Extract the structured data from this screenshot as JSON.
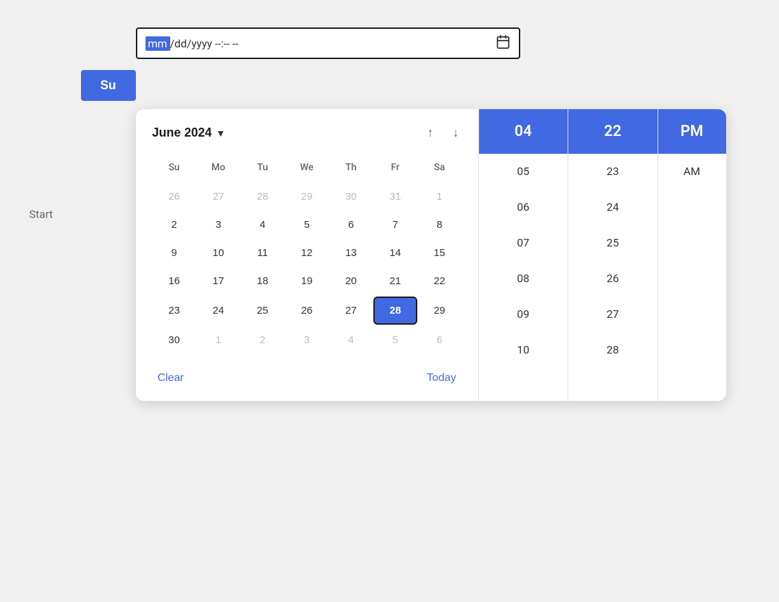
{
  "header": {
    "start_label": "Start",
    "input_placeholder": "mm/dd/yyyy --:-- --",
    "input_mm": "mm",
    "input_rest": "/dd/yyyy --:-- --",
    "calendar_icon": "📅"
  },
  "su_button": "Su",
  "calendar": {
    "month_year": "June 2024",
    "day_headers": [
      "Su",
      "Mo",
      "Tu",
      "We",
      "Th",
      "Fr",
      "Sa"
    ],
    "weeks": [
      [
        {
          "day": "26",
          "type": "other-month"
        },
        {
          "day": "27",
          "type": "other-month"
        },
        {
          "day": "28",
          "type": "other-month"
        },
        {
          "day": "29",
          "type": "other-month"
        },
        {
          "day": "30",
          "type": "other-month"
        },
        {
          "day": "31",
          "type": "other-month"
        },
        {
          "day": "1",
          "type": "other-month"
        }
      ],
      [
        {
          "day": "2",
          "type": ""
        },
        {
          "day": "3",
          "type": ""
        },
        {
          "day": "4",
          "type": ""
        },
        {
          "day": "5",
          "type": ""
        },
        {
          "day": "6",
          "type": ""
        },
        {
          "day": "7",
          "type": ""
        },
        {
          "day": "8",
          "type": ""
        }
      ],
      [
        {
          "day": "9",
          "type": ""
        },
        {
          "day": "10",
          "type": ""
        },
        {
          "day": "11",
          "type": ""
        },
        {
          "day": "12",
          "type": ""
        },
        {
          "day": "13",
          "type": ""
        },
        {
          "day": "14",
          "type": ""
        },
        {
          "day": "15",
          "type": ""
        }
      ],
      [
        {
          "day": "16",
          "type": ""
        },
        {
          "day": "17",
          "type": ""
        },
        {
          "day": "18",
          "type": ""
        },
        {
          "day": "19",
          "type": ""
        },
        {
          "day": "20",
          "type": ""
        },
        {
          "day": "21",
          "type": ""
        },
        {
          "day": "22",
          "type": ""
        }
      ],
      [
        {
          "day": "23",
          "type": ""
        },
        {
          "day": "24",
          "type": ""
        },
        {
          "day": "25",
          "type": ""
        },
        {
          "day": "26",
          "type": ""
        },
        {
          "day": "27",
          "type": ""
        },
        {
          "day": "28",
          "type": "selected"
        },
        {
          "day": "29",
          "type": ""
        }
      ],
      [
        {
          "day": "30",
          "type": ""
        },
        {
          "day": "1",
          "type": "other-month"
        },
        {
          "day": "2",
          "type": "other-month"
        },
        {
          "day": "3",
          "type": "other-month"
        },
        {
          "day": "4",
          "type": "other-month"
        },
        {
          "day": "5",
          "type": "other-month"
        },
        {
          "day": "6",
          "type": "other-month"
        }
      ]
    ],
    "footer": {
      "clear": "Clear",
      "today": "Today"
    }
  },
  "time": {
    "hours": {
      "selected": "04",
      "items": [
        "05",
        "06",
        "07",
        "08",
        "09",
        "10"
      ]
    },
    "minutes": {
      "selected": "22",
      "items": [
        "23",
        "24",
        "25",
        "26",
        "27",
        "28"
      ]
    },
    "period": {
      "selected": "PM",
      "items": [
        "AM"
      ]
    }
  }
}
